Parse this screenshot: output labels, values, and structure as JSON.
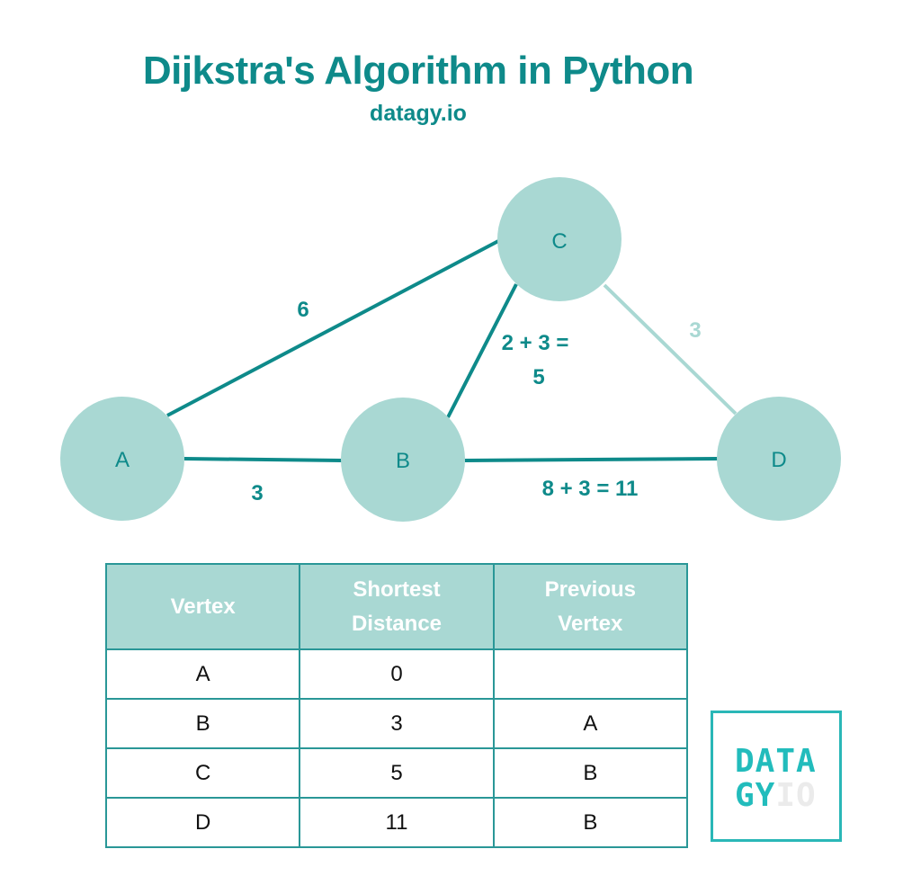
{
  "header": {
    "title": "Dijkstra's Algorithm in Python",
    "subtitle": "datagy.io"
  },
  "colors": {
    "primary": "#0e8a8a",
    "node_fill": "#a9d8d3",
    "light_edge": "#a9d8d3",
    "logo_accent": "#22bcbc",
    "logo_light": "#ebebeb"
  },
  "graph": {
    "nodes": [
      {
        "id": "A",
        "label": "A"
      },
      {
        "id": "B",
        "label": "B"
      },
      {
        "id": "C",
        "label": "C"
      },
      {
        "id": "D",
        "label": "D"
      }
    ],
    "edges": [
      {
        "from": "A",
        "to": "C",
        "label": "6",
        "style": "dark"
      },
      {
        "from": "A",
        "to": "B",
        "label": "3",
        "style": "dark"
      },
      {
        "from": "B",
        "to": "C",
        "label_line1": "2 + 3 =",
        "label_line2": "5",
        "style": "dark"
      },
      {
        "from": "C",
        "to": "D",
        "label": "3",
        "style": "light"
      },
      {
        "from": "B",
        "to": "D",
        "label": "8 + 3 = 11",
        "style": "dark"
      }
    ]
  },
  "table": {
    "headers": [
      {
        "line1": "Vertex",
        "line2": ""
      },
      {
        "line1": "Shortest",
        "line2": "Distance"
      },
      {
        "line1": "Previous",
        "line2": "Vertex"
      }
    ],
    "rows": [
      [
        "A",
        "0",
        ""
      ],
      [
        "B",
        "3",
        "A"
      ],
      [
        "C",
        "5",
        "B"
      ],
      [
        "D",
        "11",
        "B"
      ]
    ]
  },
  "logo": {
    "line1": "DATA",
    "line2_accent": "GY",
    "line2_light": "IO"
  }
}
